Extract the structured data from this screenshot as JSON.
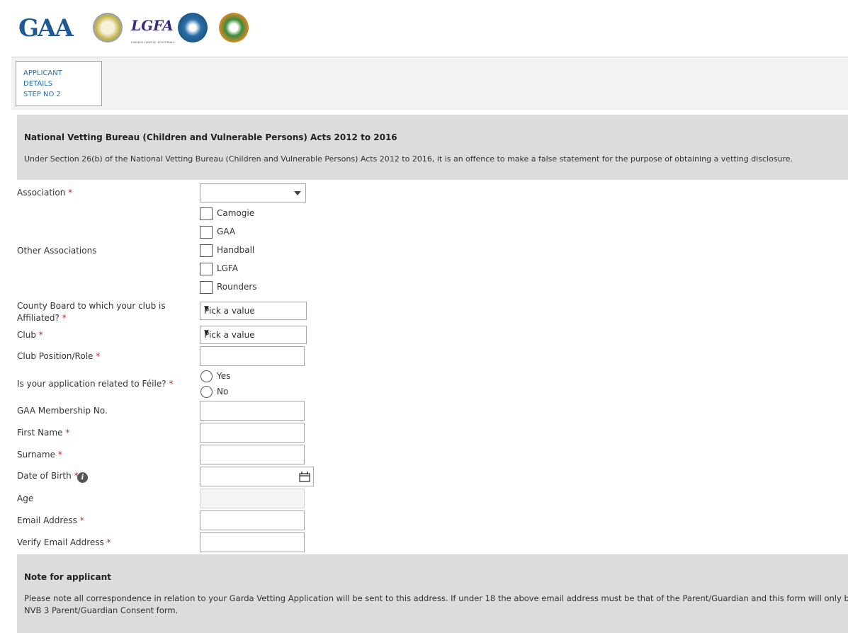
{
  "header": {
    "gaa_logo": "GAA",
    "lgfa_logo": "LGFA",
    "lgfa_sub": "LADIES GAELIC FOOTBALL"
  },
  "step": {
    "line1": "APPLICANT",
    "line2": "DETAILS",
    "line3": "STEP NO 2"
  },
  "notice": {
    "title": "National Vetting Bureau (Children and Vulnerable Persons) Acts 2012 to 2016",
    "text": "Under Section 26(b) of the National Vetting Bureau (Children and Vulnerable Persons) Acts 2012 to 2016, it is an offence to make a false statement for the purpose of obtaining a vetting disclosure."
  },
  "form": {
    "association_label": "Association",
    "required_mark": "*",
    "other_associations_label": "Other Associations",
    "other_associations": [
      "Camogie",
      "GAA",
      "Handball",
      "LGFA",
      "Rounders"
    ],
    "county_label_line1": "County Board to which your club is",
    "county_label_line2": "Affiliated?",
    "county_value": "Pick a value",
    "club_label": "Club",
    "club_value": "Pick a value",
    "role_label": "Club Position/Role",
    "feile_label": "Is your application related to Féile?",
    "feile_yes": "Yes",
    "feile_no": "No",
    "membership_label": "GAA Membership No.",
    "first_name_label": "First Name",
    "surname_label": "Surname",
    "dob_label": "Date of Birth",
    "age_label": "Age",
    "email_label": "Email Address",
    "verify_email_label": "Verify Email Address"
  },
  "note": {
    "title": "Note for applicant",
    "line1": "Please note all correspondence in relation to your Garda Vetting Application will be sent to this address. If under 18 the above email address must be that of the Parent/Guardian and this form will only be",
    "line2": "NVB 3 Parent/Guardian Consent form."
  },
  "colors": {
    "link_blue": "#1e6fb8",
    "required_red": "#d02020",
    "band_grey": "#dcdcdc"
  }
}
